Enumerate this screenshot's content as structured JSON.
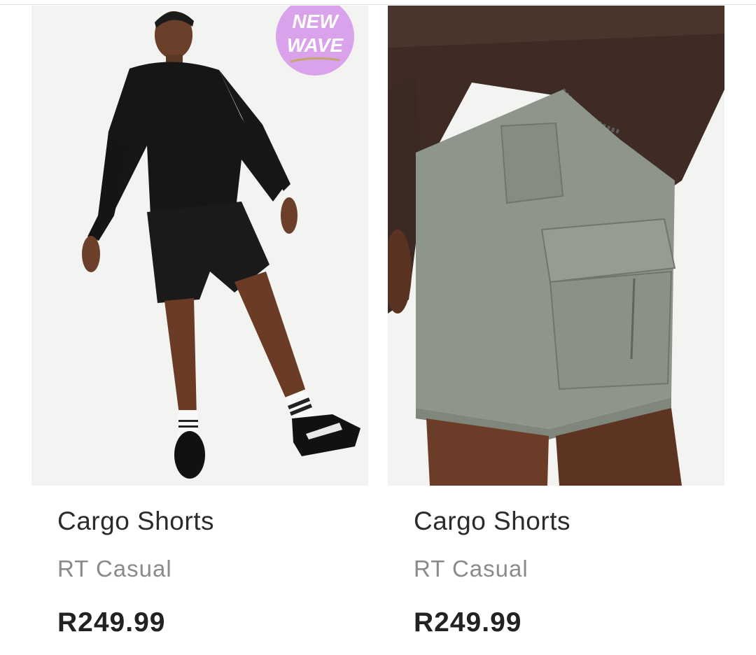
{
  "products": [
    {
      "title": "Cargo Shorts",
      "brand": "RT Casual",
      "price": "R249.99",
      "badge": {
        "line1": "NEW",
        "line2": "WAVE",
        "color": "#d9a2ea",
        "text_color": "#ffffff"
      },
      "image_icon": "model-black-hoodie-black-cargo-shorts"
    },
    {
      "title": "Cargo Shorts",
      "brand": "RT Casual",
      "price": "R249.99",
      "image_icon": "grey-cargo-shorts-closeup"
    }
  ],
  "colors": {
    "title": "#2b2b2b",
    "brand": "#8a8a8a",
    "price": "#222222",
    "image_bg": "#f3f3f1"
  }
}
